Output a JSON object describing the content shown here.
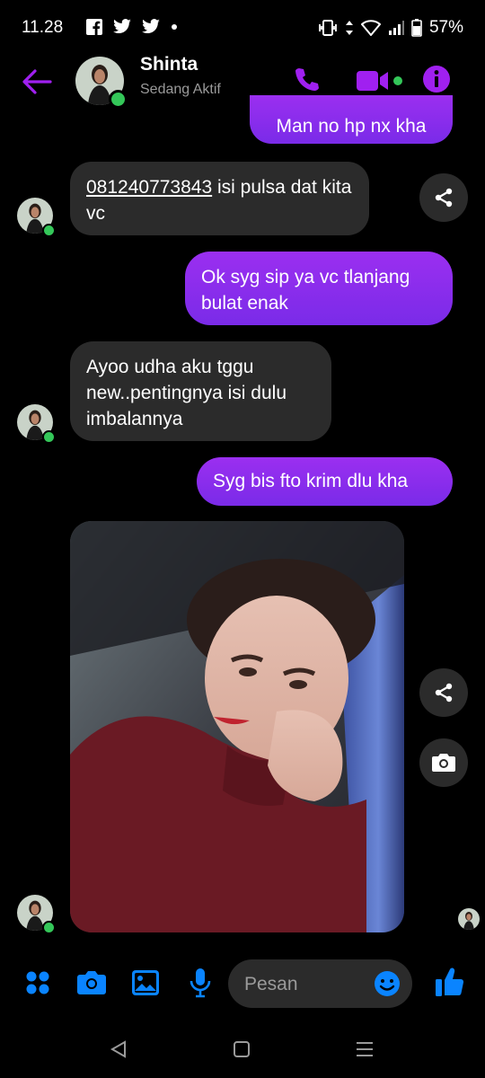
{
  "status_bar": {
    "time": "11.28",
    "battery": "57%"
  },
  "header": {
    "name": "Shinta",
    "status": "Sedang Aktif"
  },
  "messages": [
    {
      "side": "out",
      "text": "Man no hp nx kha"
    },
    {
      "side": "in",
      "link": "081240773843",
      "text": " isi pulsa dat kita vc"
    },
    {
      "side": "out",
      "text": "Ok syg sip ya vc tlanjang bulat enak"
    },
    {
      "side": "in",
      "text": "Ayoo udha aku tggu new..pentingnya isi dulu imbalannya"
    },
    {
      "side": "out",
      "text": "Syg bis fto krim dlu kha"
    },
    {
      "side": "in",
      "type": "photo"
    }
  ],
  "composer": {
    "placeholder": "Pesan"
  },
  "colors": {
    "accent": "#a020f0",
    "blue": "#0a84ff",
    "incoming": "#2b2b2b",
    "online": "#34c759"
  },
  "icons": [
    "facebook-icon",
    "twitter-icon",
    "vibrate-icon",
    "wifi-icon",
    "signal-icon",
    "battery-icon",
    "back-arrow-icon",
    "phone-icon",
    "video-call-icon",
    "info-icon",
    "share-icon",
    "camera-icon",
    "apps-icon",
    "gallery-icon",
    "microphone-icon",
    "emoji-icon",
    "like-icon"
  ]
}
